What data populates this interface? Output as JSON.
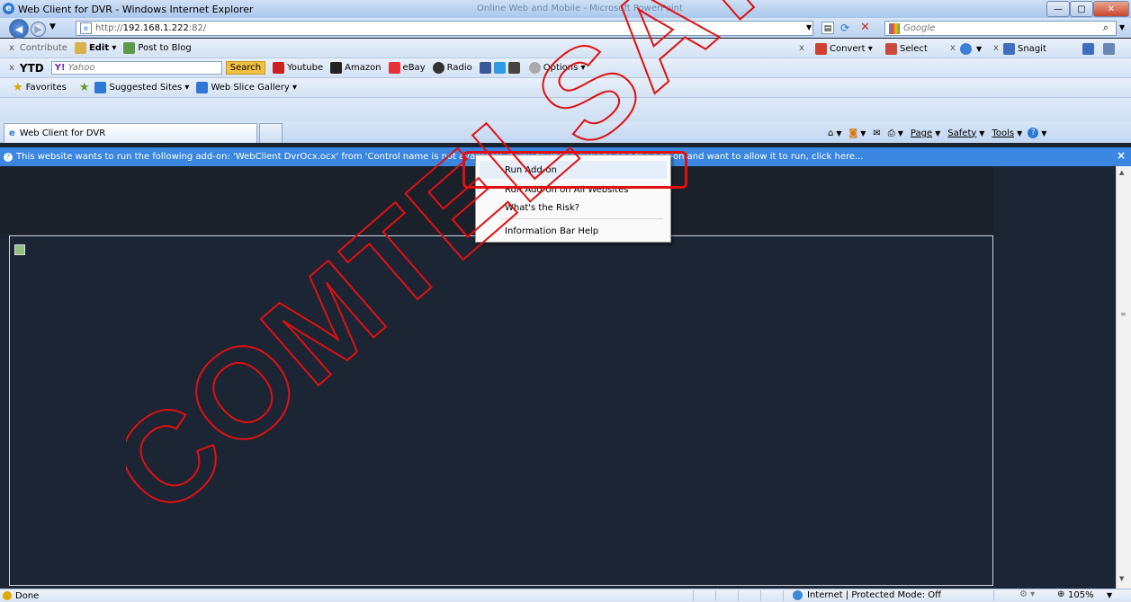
{
  "window": {
    "title": "Web Client for DVR - Windows Internet Explorer",
    "background_title": "Online Web and Mobile - Microsoft PowerPoint"
  },
  "address": {
    "url_prefix": "http://",
    "url_host": "192.168.1.222",
    "url_port": ":82/"
  },
  "search": {
    "placeholder": "Google",
    "icon": "search-icon"
  },
  "toolbar1": {
    "contribute": "Contribute",
    "edit": "Edit",
    "post_to_blog": "Post to Blog",
    "convert": "Convert",
    "select": "Select",
    "snagit": "Snagit"
  },
  "toolbar2": {
    "ytd": "YTD",
    "yahoo_placeholder": "Yahoo",
    "search_btn": "Search",
    "youtube": "Youtube",
    "amazon": "Amazon",
    "ebay": "eBay",
    "radio": "Radio",
    "options": "Options"
  },
  "favorites": {
    "favorites": "Favorites",
    "suggested": "Suggested Sites",
    "slice": "Web Slice Gallery"
  },
  "tabs": {
    "active": "Web Client for DVR"
  },
  "command": {
    "page": "Page",
    "safety": "Safety",
    "tools": "Tools"
  },
  "infobar": {
    "text": "This website wants to run the following add-on: 'WebClient DvrOcx.ocx' from 'Control name is not available'. If you trust the website and the add-on and want to allow it to run, click here...",
    "close": "×"
  },
  "menu": {
    "items": [
      "Run Add-on",
      "Run Add-on on All Websites",
      "What's the Risk?",
      "Information Bar Help"
    ]
  },
  "status": {
    "done": "Done",
    "zone": "Internet | Protected Mode: Off",
    "zoom": "105%"
  },
  "watermark": {
    "text": "COMTELSAT CO., LTD."
  },
  "colors": {
    "infobar": "#3a86e0",
    "content": "#1b2533",
    "highlight": "#e01010"
  }
}
